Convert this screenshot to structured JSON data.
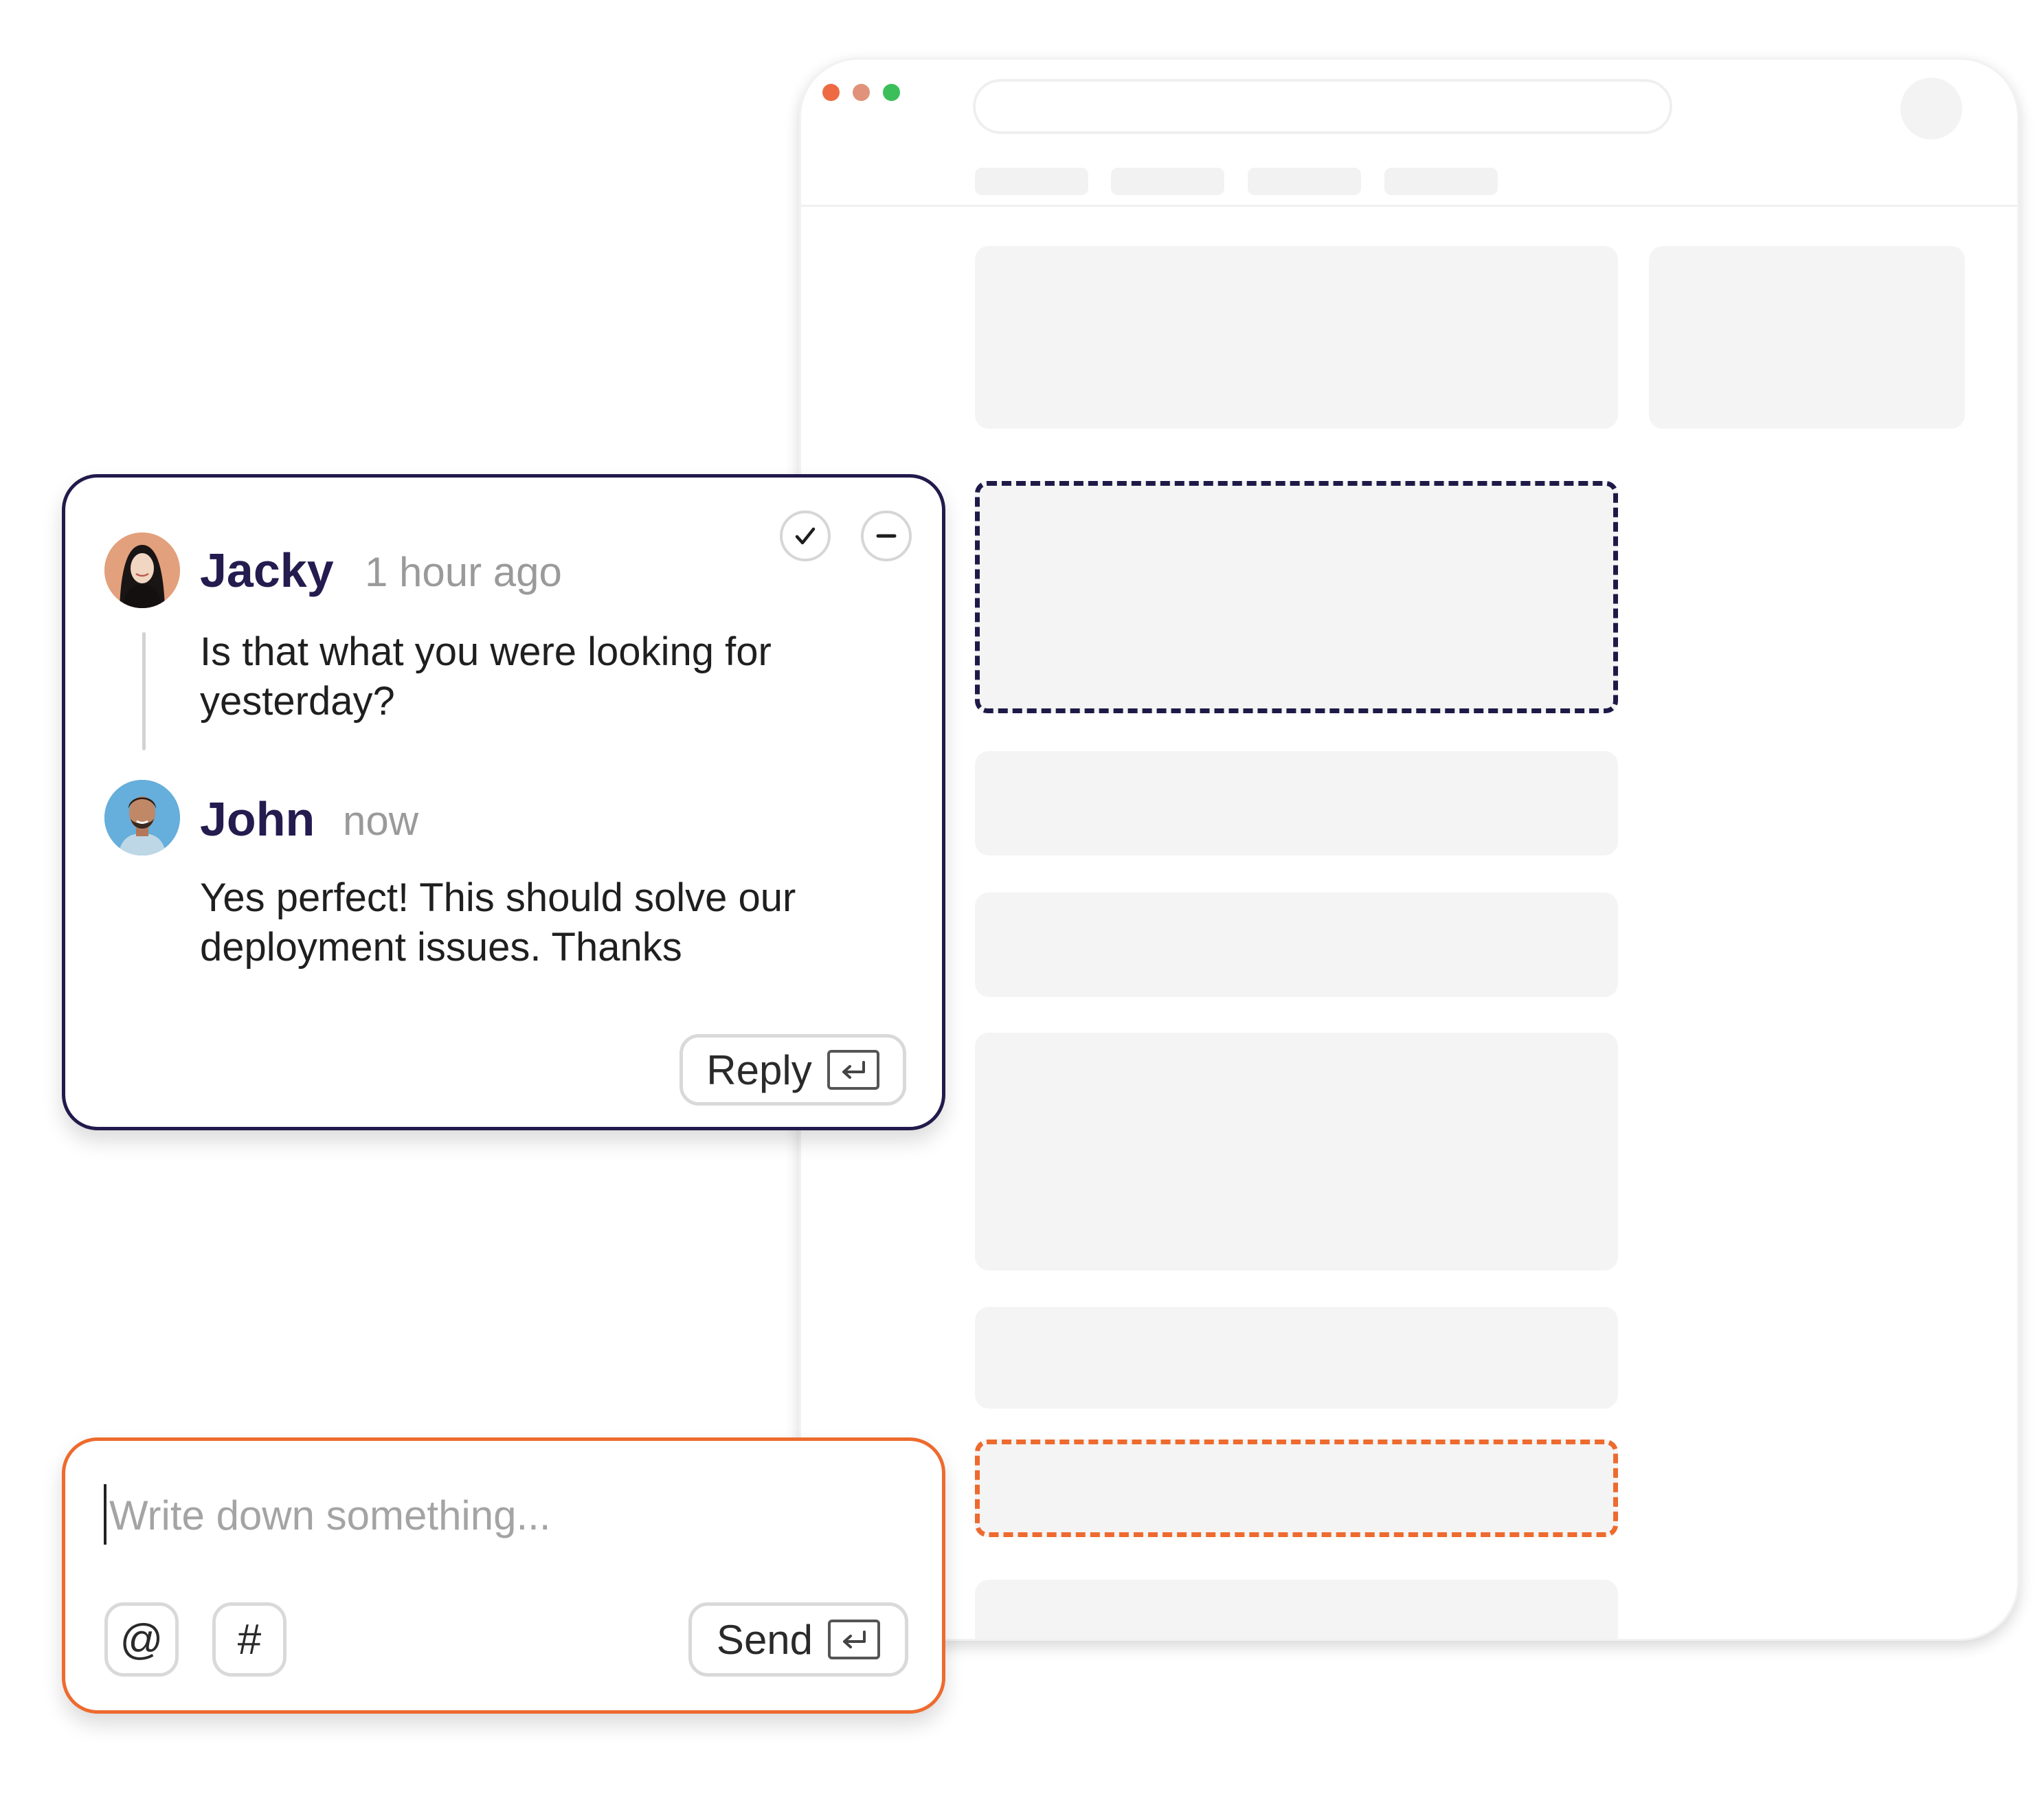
{
  "browser": {
    "window_dots": [
      {
        "name": "close",
        "color": "#ee6a42"
      },
      {
        "name": "minimize",
        "color": "#e0937a"
      },
      {
        "name": "maximize",
        "color": "#3cbf5a"
      }
    ]
  },
  "comment_thread": {
    "resolve_icon": "checkmark-icon",
    "minimize_icon": "minus-icon",
    "comments": [
      {
        "author": "Jacky",
        "time": "1 hour ago",
        "text_lines": [
          "Is that what you were looking for",
          "yesterday?"
        ]
      },
      {
        "author": "John",
        "time": "now",
        "text_lines": [
          "Yes perfect! This should solve our",
          "deployment issues. Thanks"
        ]
      }
    ],
    "reply_label": "Reply",
    "accent_color": "#221a4c"
  },
  "composer": {
    "placeholder": "Write down something...",
    "value": "",
    "mention_label": "@",
    "hashtag_label": "#",
    "send_label": "Send",
    "accent_color": "#ee6a2e"
  }
}
